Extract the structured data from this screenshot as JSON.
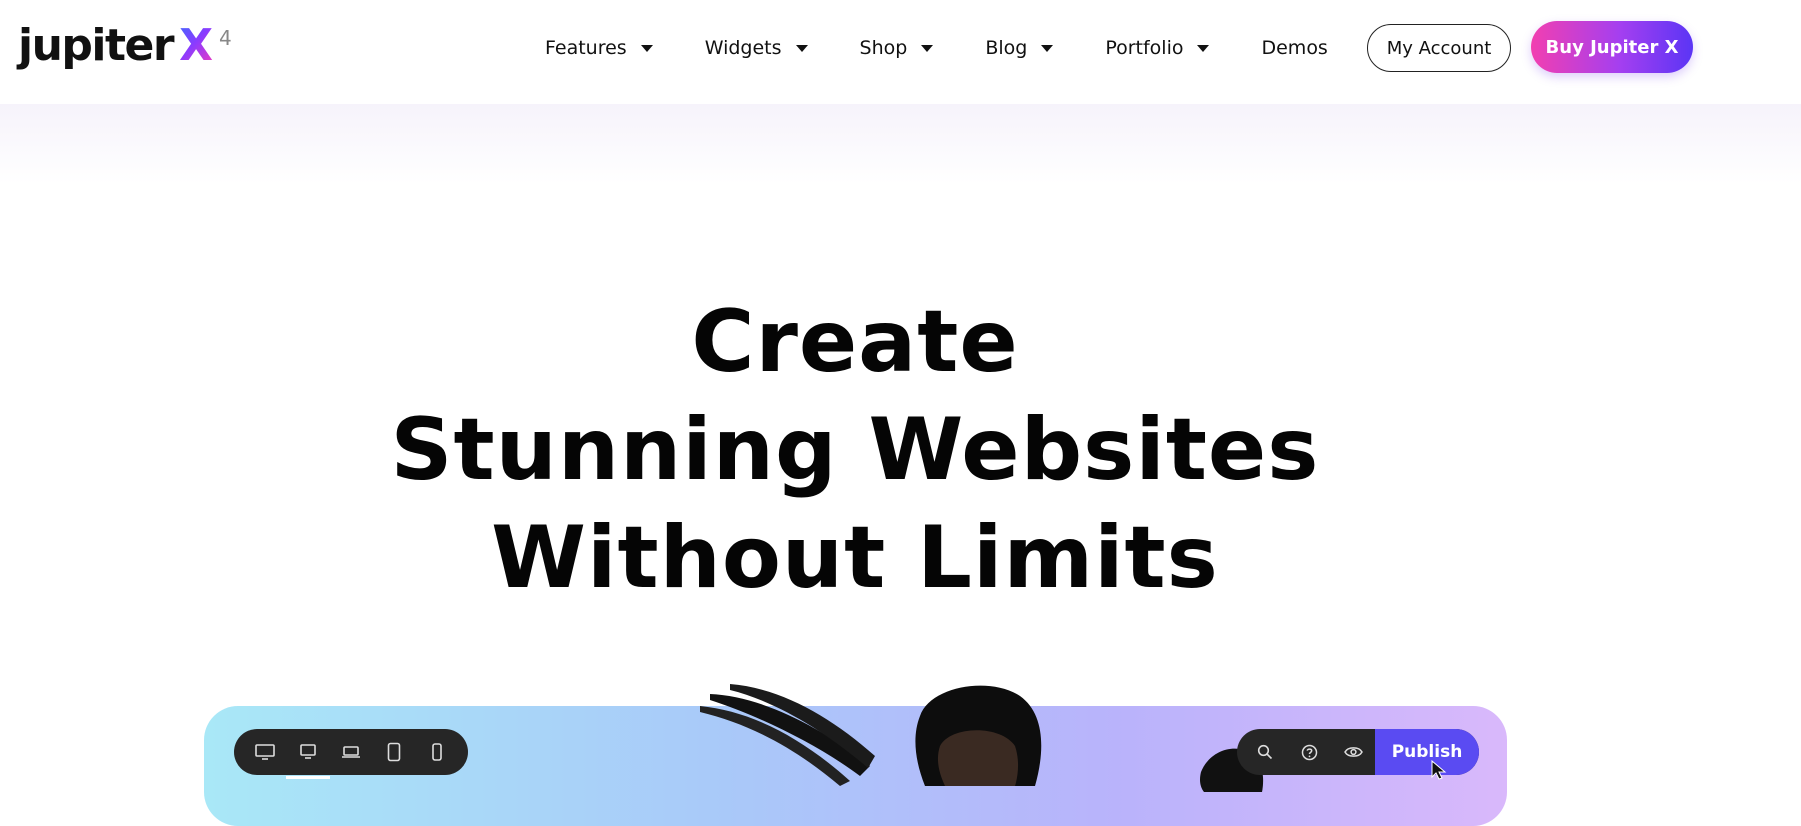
{
  "brand": {
    "logo_word": "jupiter",
    "logo_mark": "X",
    "logo_version": "4"
  },
  "nav": {
    "items": [
      {
        "label": "Features",
        "has_dropdown": true
      },
      {
        "label": "Widgets",
        "has_dropdown": true
      },
      {
        "label": "Shop",
        "has_dropdown": true
      },
      {
        "label": "Blog",
        "has_dropdown": true
      },
      {
        "label": "Portfolio",
        "has_dropdown": true
      },
      {
        "label": "Demos",
        "has_dropdown": false
      }
    ],
    "account_label": "My Account",
    "buy_label": "Buy Jupiter X"
  },
  "hero": {
    "line1": "Create",
    "line2": "Stunning Websites",
    "line3": "Without Limits"
  },
  "editor_preview": {
    "device_icons": [
      "desktop-wide-icon",
      "desktop-icon",
      "laptop-icon",
      "tablet-icon",
      "mobile-icon"
    ],
    "active_device": "desktop-icon",
    "tool_icons": [
      "search-icon",
      "help-icon",
      "eye-icon"
    ],
    "publish_label": "Publish"
  },
  "colors": {
    "accent_purple": "#5a4bf2",
    "buy_gradient_start": "#f23fb0",
    "buy_gradient_end": "#5b35f5",
    "toolbar_dark": "#262626"
  }
}
